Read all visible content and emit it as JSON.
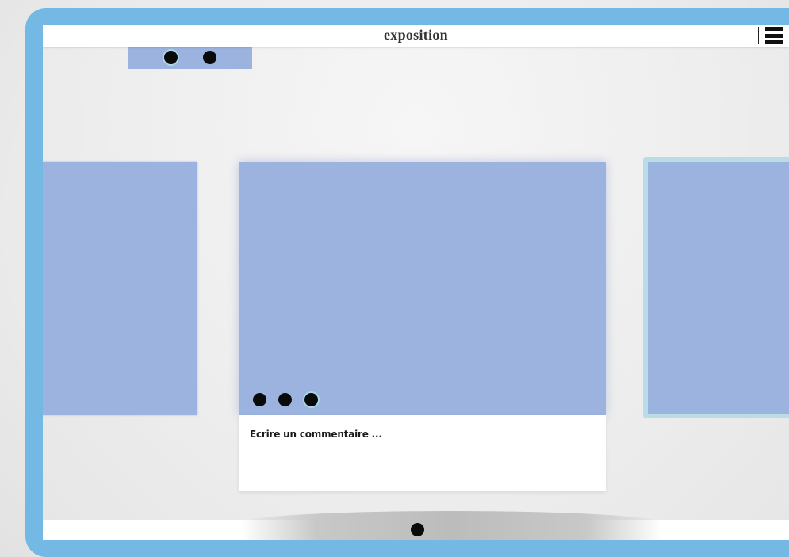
{
  "app": {
    "title": "exposition"
  },
  "comment": {
    "placeholder": "Ecrire un commentaire ..."
  },
  "colors": {
    "frame": "#74b8e4",
    "card": "#9cb3df",
    "card_selected_border": "#b9dde6",
    "dot": "#0a0a0a",
    "dot_active_ring": "#a8d8e6"
  },
  "icons": {
    "menu": "hamburger-menu-icon"
  },
  "mini_preview": {
    "dot_count": 2
  },
  "gallery": {
    "pagination": {
      "dot_count": 3,
      "active_index": 3
    }
  },
  "dock": {
    "dot_count": 1
  }
}
